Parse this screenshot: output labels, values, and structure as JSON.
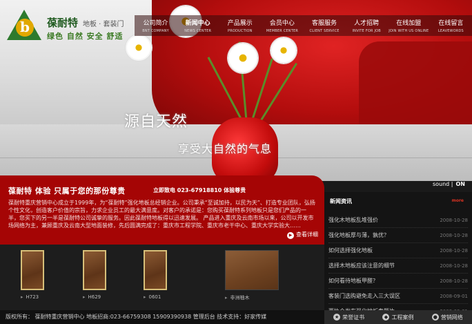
{
  "brand": {
    "name": "葆耐特",
    "sub": "地板 · 套装门",
    "tagline": "绿色 自然 安全 舒适",
    "logo_letter": "b"
  },
  "nav": [
    {
      "cn": "公司简介",
      "en": "BNT COMPANY"
    },
    {
      "cn": "新闻中心",
      "en": "NEWS CENTER"
    },
    {
      "cn": "产品展示",
      "en": "PRODUCTION"
    },
    {
      "cn": "会员中心",
      "en": "MEMBER CENTER"
    },
    {
      "cn": "客服服务",
      "en": "CLIENT SERVICE"
    },
    {
      "cn": "人才招聘",
      "en": "INVITE FOR JOB"
    },
    {
      "cn": "在线加盟",
      "en": "JOIN WITH US ONLINE"
    },
    {
      "cn": "在线留言",
      "en": "LEAVEWORDS"
    }
  ],
  "hero": {
    "slogan1": "源自天然",
    "slogan2": "享受大自然的气息",
    "sound_label": "sound |",
    "sound_state": "ON"
  },
  "intro": {
    "title": "葆耐特  体验  只属于您的那份尊贵",
    "phone": "立即致电 023-67918810 体验尊贵",
    "text": "葆耐特重庆营销中心成立于1999年，为“葆耐特”强化地板总经销企业。公司秉承“至诚加持，以民为天”、打造专业团队，弘扬个性文化，创造客户价值的宗旨，力求企业员工的最大满意度。对客户的承诺是：您购买葆耐特系列地板只是您们产品的一半，您买下的另一半是葆耐特公司诚挚的服务。因此葆耐特地板得以迅速发展。  产品进入重庆及云南市场以来，公司以开发市场网络为主，兼顾重庆及云南大型地面装修，先后圆满完成了：重庆市工程学院、重庆市老干中心、重庆大学实验大……",
    "more": "查看详细"
  },
  "products": [
    {
      "caption": "H723"
    },
    {
      "caption": "H629"
    },
    {
      "caption": "0601"
    },
    {
      "caption": "非洲柚木"
    }
  ],
  "news": {
    "title": "新闻资讯",
    "more": "more",
    "items": [
      {
        "title": "强化木地板乱堆强价",
        "date": "2008-10-28"
      },
      {
        "title": "强化地板厚与薄，孰优？",
        "date": "2008-10-28"
      },
      {
        "title": "如何选择强化地板",
        "date": "2008-10-28"
      },
      {
        "title": "选择木地板应该注意的细节",
        "date": "2008-10-28"
      },
      {
        "title": "如何看待地板甲醛？",
        "date": "2008-10-28"
      },
      {
        "title": "客装门选购避免走入三大误区",
        "date": "2008-09-01"
      },
      {
        "title": "两协会发布强化地板专题片",
        "date": "2008-09-01"
      }
    ]
  },
  "links": [
    {
      "label": "荣誉证书",
      "icon": "certificate-icon"
    },
    {
      "label": "工程案例",
      "icon": "case-icon"
    },
    {
      "label": "营销网络",
      "icon": "network-icon"
    }
  ],
  "footer": {
    "text": "版权所有：  葆耐特重庆营销中心  地板招商:023-66759308 15909390938 管理后台  技术支持：好家传媒"
  }
}
